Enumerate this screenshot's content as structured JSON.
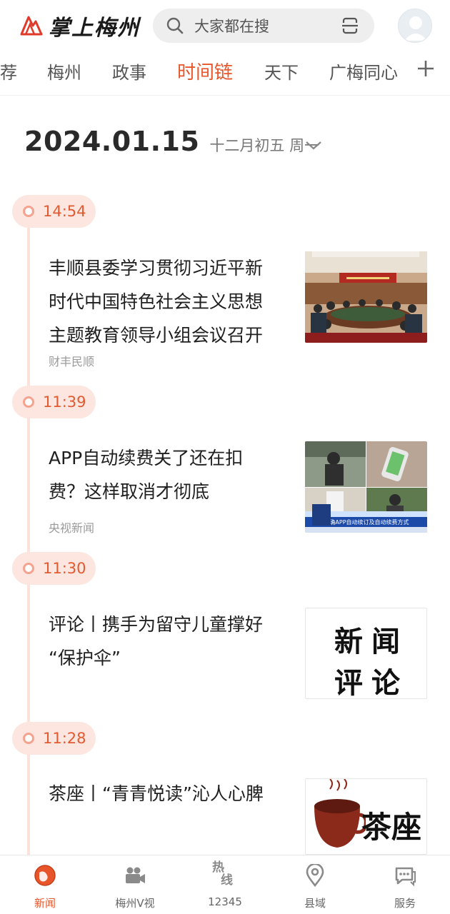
{
  "app": {
    "logo_text": "掌上梅州"
  },
  "search": {
    "placeholder": "大家都在搜"
  },
  "tabs": [
    {
      "label": "荐"
    },
    {
      "label": "梅州"
    },
    {
      "label": "政事"
    },
    {
      "label": "时间链",
      "active": true
    },
    {
      "label": "天下"
    },
    {
      "label": "广梅同心"
    }
  ],
  "date": {
    "main": "2024.01.15",
    "lunar": "十二月初五 周一"
  },
  "timeline": [
    {
      "time": "14:54",
      "title_lines": [
        "丰顺县委学习贯彻习近平新",
        "时代中国特色社会主义思想",
        "主题教育领导小组会议召开"
      ],
      "source": "财丰民顺",
      "thumb": "meeting-photo"
    },
    {
      "time": "11:39",
      "title_lines": [
        "APP自动续费关了还在扣",
        "费？这样取消才彻底"
      ],
      "source": "央视新闻",
      "thumb": "cctv-news-collage",
      "thumb_caption": "明确APP自动续订及自动续费方式"
    },
    {
      "time": "11:30",
      "title_lines": [
        "评论丨携手为留守儿童撑好",
        "“保护伞”"
      ],
      "source": "",
      "thumb": "news-commentary-calligraphy",
      "thumb_text": [
        "新闻",
        "评论"
      ]
    },
    {
      "time": "11:28",
      "title_lines": [
        "茶座丨“青青悦读”沁人心脾"
      ],
      "source": "",
      "thumb": "tea-cup-logo",
      "thumb_text": [
        "茶座"
      ]
    }
  ],
  "bottom_nav": [
    {
      "label": "新闻",
      "icon": "globe-icon",
      "active": true
    },
    {
      "label": "梅州V视",
      "icon": "video-camera-icon"
    },
    {
      "label": "12345",
      "icon": "hotline-icon",
      "icon_text": [
        "热",
        "线"
      ]
    },
    {
      "label": "县域",
      "icon": "location-pin-icon"
    },
    {
      "label": "服务",
      "icon": "chat-service-icon"
    }
  ],
  "colors": {
    "accent": "#e8552a",
    "timeline_pill": "#fde6df",
    "timeline_line": "#fbe3dc"
  }
}
